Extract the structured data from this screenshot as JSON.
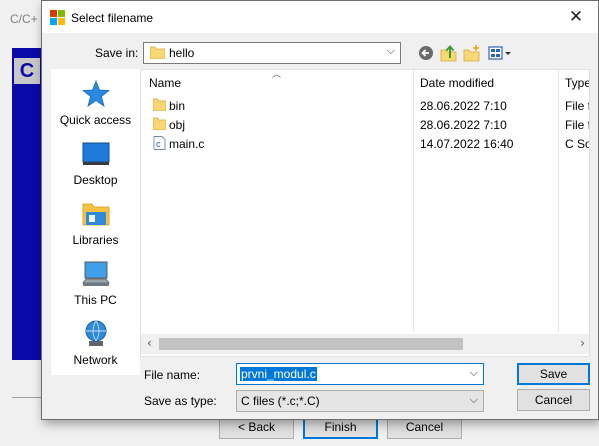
{
  "parent_window": {
    "title": "C/C+",
    "banner_letter": "C",
    "buttons": {
      "back": "< Back",
      "finish": "Finish",
      "cancel": "Cancel"
    }
  },
  "dialog": {
    "title": "Select filename",
    "close_icon": "close-icon",
    "save_in": {
      "label": "Save in:",
      "value": "hello"
    },
    "toolbar_icons": [
      "back-icon",
      "up-folder-icon",
      "new-folder-icon",
      "view-menu-icon"
    ],
    "places": [
      {
        "label": "Quick access",
        "icon": "star-icon"
      },
      {
        "label": "Desktop",
        "icon": "desktop-icon"
      },
      {
        "label": "Libraries",
        "icon": "libraries-icon"
      },
      {
        "label": "This PC",
        "icon": "computer-icon"
      },
      {
        "label": "Network",
        "icon": "network-icon"
      }
    ],
    "columns": {
      "name": "Name",
      "date": "Date modified",
      "type": "Type"
    },
    "files": [
      {
        "name": "bin",
        "date": "28.06.2022 7:10",
        "type": "File fo",
        "icon": "folder-icon"
      },
      {
        "name": "obj",
        "date": "28.06.2022 7:10",
        "type": "File fo",
        "icon": "folder-icon"
      },
      {
        "name": "main.c",
        "date": "14.07.2022 16:40",
        "type": "C Sou",
        "icon": "c-file-icon"
      }
    ],
    "file_name": {
      "label": "File name:",
      "value": "prvni_modul.c"
    },
    "save_as_type": {
      "label": "Save as type:",
      "value": "C files (*.c;*.C)"
    },
    "buttons": {
      "save": "Save",
      "cancel": "Cancel"
    },
    "colors": {
      "accent": "#0078d7",
      "folder": "#f8d775",
      "banner": "#0a0aa8"
    }
  }
}
